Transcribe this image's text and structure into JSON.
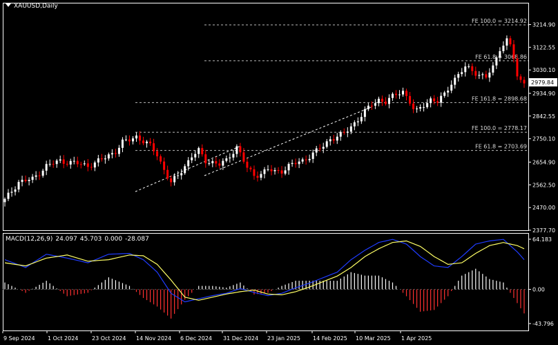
{
  "window": {
    "symbol": "XAUUSD",
    "timeframe": "Daily",
    "title": "XAUUSD,Daily"
  },
  "price_scale": [
    "3214.90",
    "3122.55",
    "3030.10",
    "2934.90",
    "2842.55",
    "2750.10",
    "2654.90",
    "2562.50",
    "2470.00",
    "2377.70"
  ],
  "current_price": "2979.84",
  "macd_scale": [
    "64.183",
    "0.00",
    "-43.796"
  ],
  "date_labels": [
    "9 Sep 2024",
    "1 Oct 2024",
    "23 Oct 2024",
    "14 Nov 2024",
    "6 Dec 2024",
    "31 Dec 2024",
    "23 Jan 2025",
    "14 Feb 2025",
    "10 Mar 2025",
    "1 Apr 2025"
  ],
  "fib_levels": [
    {
      "label": "FE 100.0 = 3214.92",
      "value": 3214.92
    },
    {
      "label": "FE 61.8 = 3068.86",
      "value": 3068.86
    },
    {
      "label": "FE 161.8 = 2898.68",
      "value": 2898.68
    },
    {
      "label": "FE 100.0 = 2778.17",
      "value": 2778.17
    },
    {
      "label": "FE 61.8 = 2703.69",
      "value": 2703.69
    }
  ],
  "macd": {
    "name": "MACD(12,26,9)",
    "values": [
      "24.097",
      "45.703",
      "0.000",
      "-28.087"
    ]
  },
  "colors": {
    "background": "#000000",
    "bull": "#ffffff",
    "bear": "#ff0000",
    "macd_line": "#1f3cff",
    "signal_line": "#ffff66",
    "hist_pos": "#ffffff",
    "hist_neg": "#ff3030",
    "grid": "#ffffff"
  },
  "chart_data": {
    "type": "candlestick",
    "x_labels": [
      "9 Sep 2024",
      "1 Oct 2024",
      "23 Oct 2024",
      "14 Nov 2024",
      "6 Dec 2024",
      "31 Dec 2024",
      "23 Jan 2025",
      "14 Feb 2025",
      "10 Mar 2025",
      "1 Apr 2025"
    ],
    "ylim": [
      2377.7,
      3253.0
    ],
    "close_path": [
      [
        0,
        2500
      ],
      [
        4,
        2575
      ],
      [
        8,
        2585
      ],
      [
        12,
        2640
      ],
      [
        16,
        2660
      ],
      [
        20,
        2652
      ],
      [
        24,
        2640
      ],
      [
        28,
        2665
      ],
      [
        32,
        2700
      ],
      [
        34,
        2735
      ],
      [
        36,
        2745
      ],
      [
        38,
        2760
      ],
      [
        40,
        2740
      ],
      [
        42,
        2720
      ],
      [
        44,
        2685
      ],
      [
        46,
        2625
      ],
      [
        48,
        2570
      ],
      [
        50,
        2600
      ],
      [
        52,
        2640
      ],
      [
        54,
        2680
      ],
      [
        56,
        2700
      ],
      [
        58,
        2660
      ],
      [
        60,
        2655
      ],
      [
        62,
        2645
      ],
      [
        64,
        2660
      ],
      [
        66,
        2700
      ],
      [
        67,
        2718
      ],
      [
        68,
        2690
      ],
      [
        70,
        2630
      ],
      [
        72,
        2600
      ],
      [
        74,
        2610
      ],
      [
        76,
        2625
      ],
      [
        78,
        2615
      ],
      [
        80,
        2620
      ],
      [
        82,
        2640
      ],
      [
        84,
        2650
      ],
      [
        86,
        2660
      ],
      [
        88,
        2680
      ],
      [
        90,
        2700
      ],
      [
        92,
        2720
      ],
      [
        94,
        2750
      ],
      [
        96,
        2760
      ],
      [
        98,
        2770
      ],
      [
        100,
        2800
      ],
      [
        102,
        2830
      ],
      [
        104,
        2860
      ],
      [
        106,
        2890
      ],
      [
        108,
        2910
      ],
      [
        110,
        2900
      ],
      [
        112,
        2920
      ],
      [
        114,
        2940
      ],
      [
        115,
        2945
      ],
      [
        117,
        2900
      ],
      [
        118,
        2870
      ],
      [
        119,
        2860
      ],
      [
        121,
        2890
      ],
      [
        123,
        2910
      ],
      [
        125,
        2900
      ],
      [
        127,
        2930
      ],
      [
        129,
        2980
      ],
      [
        131,
        3010
      ],
      [
        133,
        3040
      ],
      [
        135,
        3030
      ],
      [
        137,
        3010
      ],
      [
        139,
        3000
      ],
      [
        141,
        3040
      ],
      [
        143,
        3120
      ],
      [
        145,
        3150
      ],
      [
        146,
        3130
      ],
      [
        147,
        3080
      ],
      [
        148,
        3000
      ],
      [
        149,
        2985
      ],
      [
        150,
        2985
      ]
    ],
    "macd_path": [
      [
        0,
        38
      ],
      [
        6,
        28
      ],
      [
        12,
        45
      ],
      [
        18,
        40
      ],
      [
        24,
        34
      ],
      [
        30,
        45
      ],
      [
        36,
        46
      ],
      [
        40,
        38
      ],
      [
        44,
        22
      ],
      [
        48,
        -5
      ],
      [
        52,
        -16
      ],
      [
        56,
        -12
      ],
      [
        60,
        -8
      ],
      [
        64,
        -5
      ],
      [
        68,
        1
      ],
      [
        72,
        -4
      ],
      [
        76,
        -8
      ],
      [
        80,
        -5
      ],
      [
        84,
        2
      ],
      [
        88,
        8
      ],
      [
        92,
        15
      ],
      [
        96,
        22
      ],
      [
        100,
        38
      ],
      [
        104,
        50
      ],
      [
        108,
        60
      ],
      [
        112,
        64
      ],
      [
        116,
        58
      ],
      [
        120,
        42
      ],
      [
        124,
        30
      ],
      [
        128,
        28
      ],
      [
        132,
        42
      ],
      [
        136,
        58
      ],
      [
        140,
        62
      ],
      [
        144,
        64
      ],
      [
        148,
        48
      ],
      [
        150,
        38
      ]
    ],
    "signal_path": [
      [
        0,
        34
      ],
      [
        6,
        30
      ],
      [
        12,
        40
      ],
      [
        18,
        44
      ],
      [
        24,
        36
      ],
      [
        30,
        38
      ],
      [
        36,
        44
      ],
      [
        40,
        43
      ],
      [
        44,
        32
      ],
      [
        48,
        12
      ],
      [
        52,
        -10
      ],
      [
        56,
        -14
      ],
      [
        60,
        -10
      ],
      [
        64,
        -6
      ],
      [
        68,
        -3
      ],
      [
        72,
        -1
      ],
      [
        76,
        -6
      ],
      [
        80,
        -7
      ],
      [
        84,
        -3
      ],
      [
        88,
        3
      ],
      [
        92,
        10
      ],
      [
        96,
        17
      ],
      [
        100,
        28
      ],
      [
        104,
        42
      ],
      [
        108,
        52
      ],
      [
        112,
        60
      ],
      [
        116,
        62
      ],
      [
        120,
        55
      ],
      [
        124,
        42
      ],
      [
        128,
        32
      ],
      [
        132,
        34
      ],
      [
        136,
        46
      ],
      [
        140,
        56
      ],
      [
        144,
        60
      ],
      [
        148,
        56
      ],
      [
        150,
        52
      ]
    ],
    "histogram_ylim": [
      -43.796,
      64.183
    ]
  }
}
